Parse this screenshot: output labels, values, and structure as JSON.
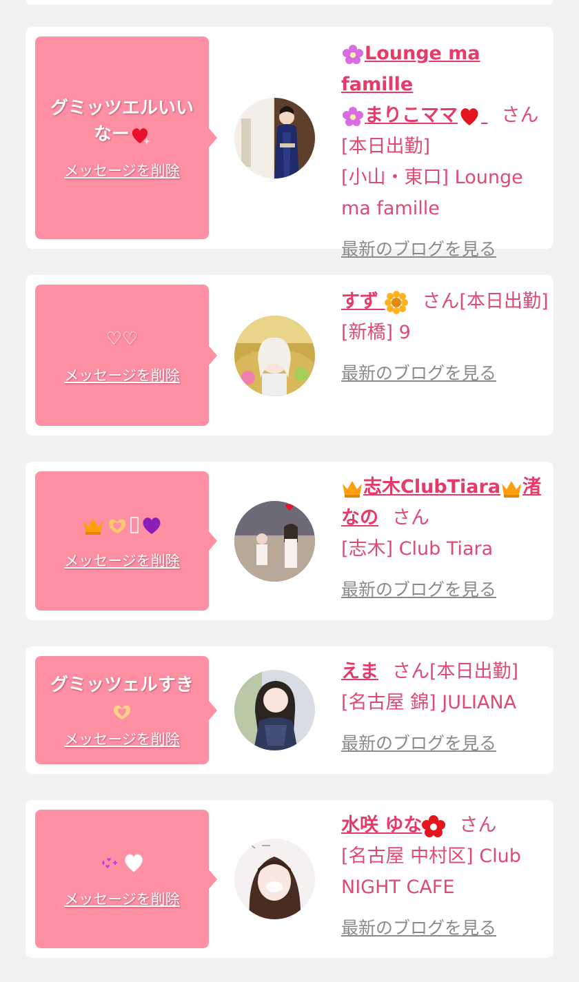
{
  "cards": [
    {
      "message": "グミッツエルいいなー",
      "delete_label": "メッセージを削除",
      "name_prefix": "Lounge ma famille",
      "name": "まりこママ",
      "honorific": "さん",
      "status": "[本日出勤]",
      "location": "[小山・東口] Lounge ma famille",
      "blog_link": "最新のブログを見る"
    },
    {
      "message": "♡♡",
      "delete_label": "メッセージを削除",
      "name": "すず",
      "honorific": "さん",
      "status": "[本日出勤]",
      "location": "[新橋] 9",
      "blog_link": "最新のブログを見る"
    },
    {
      "message": "",
      "delete_label": "メッセージを削除",
      "name": "志木ClubTiara",
      "name_suffix": "渚なの",
      "honorific": "さん",
      "status": "",
      "location": "[志木] Club Tiara",
      "blog_link": "最新のブログを見る"
    },
    {
      "message": "グミッツェルすき",
      "delete_label": "メッセージを削除",
      "name": "えま",
      "honorific": "さん",
      "status": "[本日出勤]",
      "location": "[名古屋 錦] JULIANA",
      "blog_link": "最新のブログを見る"
    },
    {
      "message": "",
      "delete_label": "メッセージを削除",
      "name": "水咲 ゆな",
      "honorific": "さん",
      "status": "",
      "location": "[名古屋 中村区] Club NIGHT CAFE",
      "blog_link": "最新のブログを見る"
    }
  ],
  "colors": {
    "background": "#f2f2f2",
    "card": "#ffffff",
    "bubble": "#ff8fa3",
    "name": "#e63a68",
    "text": "#e04a72",
    "blog_link": "#8a8a8a"
  },
  "icons": [
    "flower-icon",
    "heart-icon",
    "sparkle-heart-icon",
    "sun-flower-icon",
    "crown-icon",
    "heart-hands-icon",
    "purple-heart-icon",
    "white-heart-icon",
    "red-flower-icon"
  ]
}
